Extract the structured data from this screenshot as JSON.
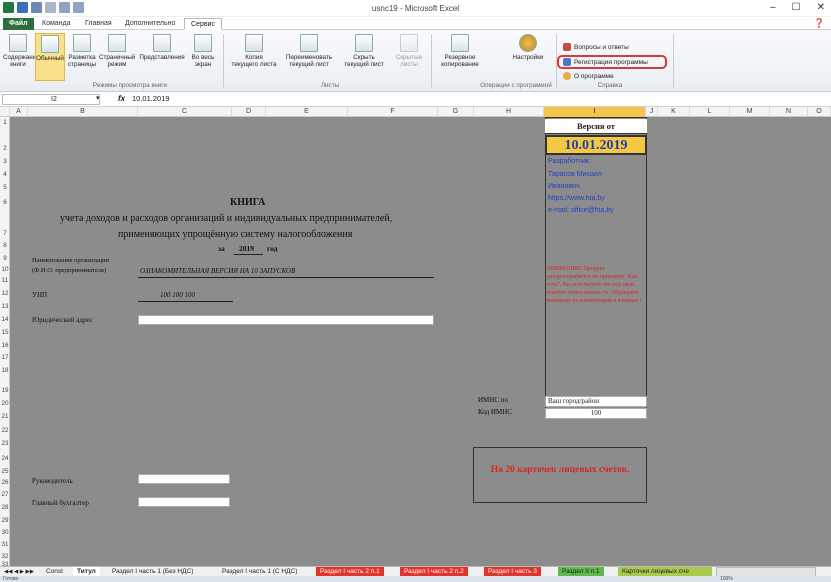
{
  "window": {
    "title": "usnc19 - Microsoft Excel",
    "minimize": "–",
    "maximize": "☐",
    "close": "✕"
  },
  "tabs": [
    {
      "label": "Файл"
    },
    {
      "label": "Команда"
    },
    {
      "label": "Главная"
    },
    {
      "label": "Дополнительно"
    },
    {
      "label": "Сервис"
    }
  ],
  "ribbon": {
    "views": [
      {
        "label1": "Содержание",
        "label2": "книги"
      },
      {
        "label1": "Обычный",
        "label2": ""
      },
      {
        "label1": "Разметка",
        "label2": "страницы"
      },
      {
        "label1": "Страничный",
        "label2": "режим"
      },
      {
        "label1": "Представления",
        "label2": ""
      },
      {
        "label1": "Во весь",
        "label2": "экран"
      }
    ],
    "views_group": "Режимы просмотра книги",
    "sheets": [
      {
        "label1": "Копия",
        "label2": "текущего листа"
      },
      {
        "label1": "Переименовать",
        "label2": "текущий лист"
      },
      {
        "label1": "Скрыть",
        "label2": "текущий лист"
      },
      {
        "label1": "Скрытые",
        "label2": "листы"
      }
    ],
    "sheets_group": "Листы",
    "ops": [
      {
        "label1": "Резервное",
        "label2": "копирование"
      },
      {
        "label1": "Настройки",
        "label2": ""
      }
    ],
    "ops_group": "Операции с программой",
    "help": {
      "qa": "Вопросы и ответы",
      "reg": "Регистрация программы",
      "about": "О программе"
    },
    "help_group": "Справка"
  },
  "formula_bar": {
    "cell": "I2",
    "fx": "fx",
    "value": "10.01.2019"
  },
  "columns": [
    "A",
    "B",
    "C",
    "D",
    "E",
    "F",
    "G",
    "H",
    "I",
    "J",
    "K",
    "L",
    "M",
    "N",
    "O"
  ],
  "rows": [
    "1",
    "2",
    "3",
    "4",
    "5",
    "6",
    "7",
    "8",
    "9",
    "10",
    "11",
    "12",
    "13",
    "14",
    "15",
    "16",
    "17",
    "18",
    "19",
    "20",
    "21",
    "22",
    "23",
    "24",
    "25",
    "26",
    "27",
    "28",
    "29",
    "30",
    "31",
    "32",
    "33"
  ],
  "doc": {
    "title": "КНИГА",
    "subtitle1": "учета доходов и расходов организаций и индивидуальных предпринимателей,",
    "subtitle2": "применяющих упрощённую систему налогообложения",
    "year_prefix": "за",
    "year": "2019",
    "year_suffix": "год",
    "org_label1": "Наименование организации",
    "org_label2": "(Ф.И.О. предпринимателя)",
    "org_value": "ОЗНАКОМИТЕЛЬНАЯ ВЕРСИЯ НА 10 ЗАПУСКОВ",
    "unp_label": "УНП",
    "unp_value": "100 100 100",
    "address_label": "Юридический адрес",
    "imns_label": "ИМНС по",
    "imns_value": "Ваш город/район",
    "imns_code_label": "Код ИМНС",
    "imns_code_value": "100",
    "head_label": "Руководитель",
    "accountant_label": "Главный бухгалтер"
  },
  "version_panel": {
    "title": "Версия от",
    "date": "10.01.2019",
    "dev_label": "Разработчик:",
    "dev_name1": "Тарасов Михаил",
    "dev_name2": "Иванович",
    "site": "https://www.hta.by",
    "email": "e-mail: office@hta.by",
    "warning": "ВНИМАНИЕ! Продукт распространяется по принципу \"Как есть\". Вы используете его под свою полную ответственность. Обращайте внимание на комментарии к ячейкам !",
    "cards": "На 20 карточек лицевых счетов."
  },
  "sheet_tabs": [
    {
      "label": "Const"
    },
    {
      "label": "Титул"
    },
    {
      "label": "Раздел I часть 1 (Без НДС)"
    },
    {
      "label": "Раздел I часть 1 (С НДС)"
    },
    {
      "label": "Раздел I часть 2 п.1"
    },
    {
      "label": "Раздел I часть 2 п.2"
    },
    {
      "label": "Раздел I часть 3"
    },
    {
      "label": "Раздел II п.1"
    },
    {
      "label": "Карточки лицевых сче"
    }
  ],
  "status": {
    "text": "Готово",
    "zoom": "100%"
  },
  "colors": {
    "accent_red": "#d8261f",
    "link_blue": "#2242c6",
    "date_yellow": "#f5c842"
  }
}
